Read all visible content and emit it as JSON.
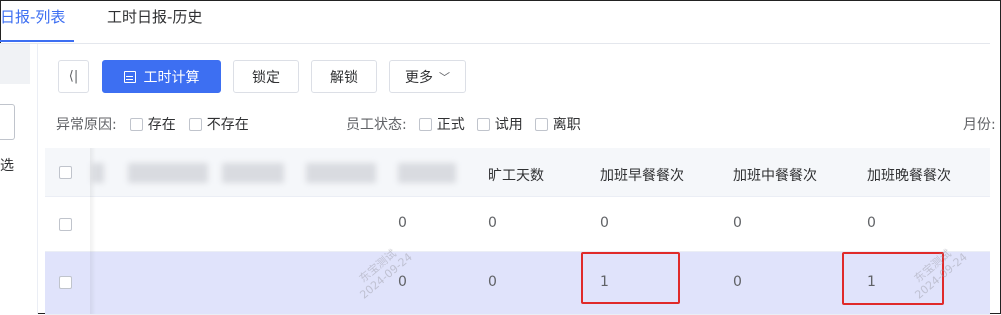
{
  "tabs": {
    "active": "日报-列表",
    "inactive": "工时日报-历史"
  },
  "sidebar": {
    "filter_text": "选"
  },
  "toolbar": {
    "collapse_icon": "collapse-left-icon",
    "collapse_glyph": "⟨|",
    "calc_label": "工时计算",
    "lock_label": "锁定",
    "unlock_label": "解锁",
    "more_label": "更多",
    "more_chevron": "﹀",
    "primary_color": "#3d6ff2"
  },
  "filters": {
    "abnormal_label": "异常原因:",
    "abnormal_options": [
      "存在",
      "不存在"
    ],
    "employee_label": "员工状态:",
    "employee_options": [
      "正式",
      "试用",
      "离职"
    ],
    "month_label": "月份:"
  },
  "table": {
    "headers": [
      "旷工天数",
      "加班早餐餐次",
      "加班中餐餐次",
      "加班晚餐餐次"
    ],
    "rows": [
      {
        "c0": "0",
        "c1": "0",
        "c2": "0",
        "c3": "0",
        "c4": "0"
      },
      {
        "c0": "0",
        "c1": "0",
        "c2": "1",
        "c3": "0",
        "c4": "1"
      }
    ],
    "selected_row_color": "#e0e3fb",
    "highlight_color": "#e02a2a"
  },
  "watermark": {
    "name": "东宝测试",
    "date": "2024-09-24"
  }
}
